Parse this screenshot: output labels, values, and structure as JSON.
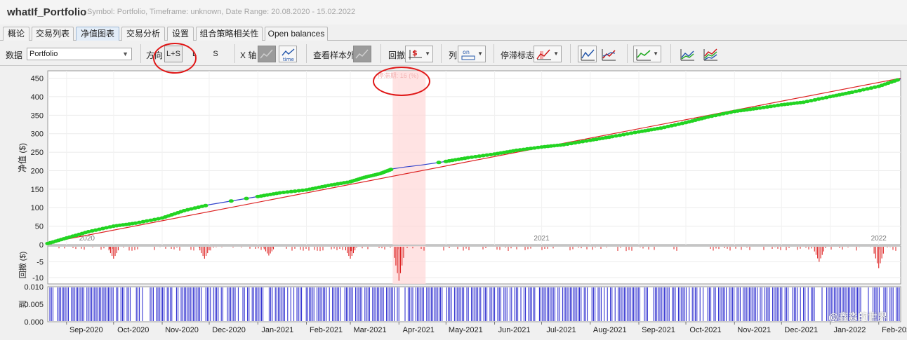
{
  "header": {
    "title": "whatIf_Portfolio",
    "subtitle": "Symbol: Portfolio, Timeframe: unknown, Date Range: 20.08.2020 - 15.02.2022"
  },
  "tabs": [
    {
      "label": "概论",
      "active": false
    },
    {
      "label": "交易列表",
      "active": false
    },
    {
      "label": "净值图表",
      "active": true
    },
    {
      "label": "交易分析",
      "active": false
    },
    {
      "label": "设置",
      "active": false
    },
    {
      "label": "组合策略相关性",
      "active": false
    },
    {
      "label": "Open balances",
      "active": false
    }
  ],
  "toolbar": {
    "data_label": "数据",
    "data_value": "Portfolio",
    "direction_label": "方向",
    "dir_ls": "L+S",
    "dir_l": "L",
    "dir_s": "S",
    "xaxis_label": "X 轴",
    "oos_label": "查看样本外",
    "drawdown_label": "回撤",
    "columns_label": "列",
    "stagnation_label": "停滞标志",
    "icons": [
      "xaxis-trades-icon",
      "xaxis-time-icon",
      "oos-chart-icon",
      "drawdown-dollar-icon",
      "columns-on-icon",
      "stagnation-icon",
      "chart-type-a-icon",
      "chart-type-b-icon",
      "chart-style-icon",
      "equity-lines-icon",
      "equity-multi-icon"
    ]
  },
  "colors": {
    "equity_marker": "#22d422",
    "equity_line": "#3344cc",
    "trend_line": "#dd2222",
    "drawdown_bar": "#dd2222",
    "volume_bar": "#2222cc",
    "highlight": "#ffd9d9",
    "annotation_circle": "#e01818"
  },
  "annotation": {
    "stagnation_text": "停滞期: 16  (%)"
  },
  "watermark": "@鑫淼的世界",
  "chart_data": [
    {
      "type": "line",
      "ylabel": "净值 ($)",
      "ylim": [
        0,
        470
      ],
      "yticks": [
        0,
        50,
        100,
        150,
        200,
        250,
        300,
        350,
        400,
        450
      ],
      "year_labels": [
        {
          "label": "2020",
          "x": "2020-09-14"
        },
        {
          "label": "2021",
          "x": "2021-07-01"
        },
        {
          "label": "2022",
          "x": "2022-02-01"
        }
      ],
      "series": [
        {
          "x": [
            "2020-08-20",
            "2020-09-01",
            "2020-09-15",
            "2020-10-01",
            "2020-10-15",
            "2020-11-01",
            "2020-11-15",
            "2020-12-01",
            "2020-12-15",
            "2021-01-01",
            "2021-01-15",
            "2021-02-01",
            "2021-02-15",
            "2021-03-01",
            "2021-03-10",
            "2021-03-20",
            "2021-03-28",
            "2021-04-05",
            "2021-04-15",
            "2021-05-01",
            "2021-05-15",
            "2021-06-01",
            "2021-06-15",
            "2021-07-01",
            "2021-07-15",
            "2021-08-01",
            "2021-08-15",
            "2021-09-01",
            "2021-09-15",
            "2021-10-01",
            "2021-10-15",
            "2021-11-01",
            "2021-11-15",
            "2021-12-01",
            "2021-12-15",
            "2022-01-01",
            "2022-01-15",
            "2022-02-01",
            "2022-02-15"
          ],
          "values": [
            3,
            18,
            35,
            50,
            58,
            72,
            92,
            108,
            118,
            130,
            140,
            148,
            160,
            170,
            182,
            192,
            205,
            210,
            215,
            225,
            235,
            245,
            255,
            264,
            270,
            282,
            292,
            305,
            315,
            330,
            345,
            360,
            368,
            378,
            385,
            400,
            412,
            428,
            448
          ]
        },
        {
          "x": [
            "2020-08-20",
            "2022-02-15"
          ],
          "values": [
            5,
            450
          ]
        }
      ],
      "stagnation_period": [
        "2021-03-28",
        "2021-04-18"
      ]
    },
    {
      "type": "bar",
      "ylabel": "回撤 ($)",
      "ylim": [
        -12,
        0
      ],
      "yticks": [
        -5,
        -10
      ],
      "notable_drops": [
        {
          "x": "2020-10-01",
          "value": -4
        },
        {
          "x": "2020-11-28",
          "value": -4
        },
        {
          "x": "2021-01-08",
          "value": -3
        },
        {
          "x": "2021-03-01",
          "value": -4
        },
        {
          "x": "2021-04-01",
          "value": -11
        },
        {
          "x": "2021-12-25",
          "value": -5
        },
        {
          "x": "2022-02-01",
          "value": -7
        }
      ]
    },
    {
      "type": "bar",
      "ylabel": "到",
      "ylim": [
        0,
        0.01
      ],
      "yticks": [
        "0.000",
        "0.005",
        "0.010"
      ],
      "months": [
        "Sep-2020",
        "Oct-2020",
        "Nov-2020",
        "Dec-2020",
        "Jan-2021",
        "Feb-2021",
        "Mar-2021",
        "Apr-2021",
        "May-2021",
        "Jun-2021",
        "Jul-2021",
        "Aug-2021",
        "Sep-2021",
        "Oct-2021",
        "Nov-2021",
        "Dec-2021",
        "Jan-2022",
        "Feb-2022"
      ]
    }
  ]
}
